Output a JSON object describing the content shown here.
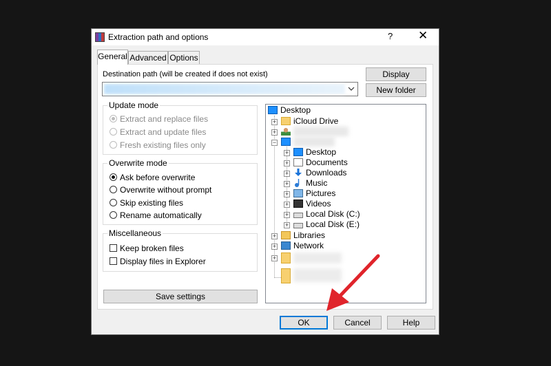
{
  "window": {
    "title": "Extraction path and options",
    "help_label": "?",
    "close_label": "✕"
  },
  "tabs": [
    {
      "label": "General"
    },
    {
      "label": "Advanced"
    },
    {
      "label": "Options"
    }
  ],
  "destination": {
    "label": "Destination path (will be created if does not exist)",
    "value": "",
    "dropdown_icon": "chevron-down-icon"
  },
  "side_buttons": {
    "display": "Display",
    "new_folder": "New folder"
  },
  "update_mode": {
    "title": "Update mode",
    "options": [
      {
        "label": "Extract and replace files",
        "checked": true
      },
      {
        "label": "Extract and update files",
        "checked": false
      },
      {
        "label": "Fresh existing files only",
        "checked": false
      }
    ]
  },
  "overwrite_mode": {
    "title": "Overwrite mode",
    "options": [
      {
        "label": "Ask before overwrite",
        "checked": true
      },
      {
        "label": "Overwrite without prompt",
        "checked": false
      },
      {
        "label": "Skip existing files",
        "checked": false
      },
      {
        "label": "Rename automatically",
        "checked": false
      }
    ]
  },
  "misc": {
    "title": "Miscellaneous",
    "options": [
      {
        "label": "Keep broken files",
        "checked": false
      },
      {
        "label": "Display files in Explorer",
        "checked": false
      }
    ]
  },
  "save_settings": "Save settings",
  "tree": {
    "root": "Desktop",
    "items": [
      {
        "label": "iCloud Drive",
        "icon": "folder-icon"
      },
      {
        "label": "",
        "icon": "user-icon"
      },
      {
        "label": "",
        "icon": "monitor-icon"
      },
      {
        "label": "Desktop",
        "icon": "monitor-icon"
      },
      {
        "label": "Documents",
        "icon": "document-icon"
      },
      {
        "label": "Downloads",
        "icon": "download-icon"
      },
      {
        "label": "Music",
        "icon": "music-icon"
      },
      {
        "label": "Pictures",
        "icon": "pictures-icon"
      },
      {
        "label": "Videos",
        "icon": "videos-icon"
      },
      {
        "label": "Local Disk (C:)",
        "icon": "disk-icon"
      },
      {
        "label": "Local Disk (E:)",
        "icon": "disk-icon"
      },
      {
        "label": "Libraries",
        "icon": "libraries-icon"
      },
      {
        "label": "Network",
        "icon": "network-icon"
      },
      {
        "label": "",
        "icon": "folder-icon"
      },
      {
        "label": "",
        "icon": "folder-icon"
      }
    ]
  },
  "footer": {
    "ok": "OK",
    "cancel": "Cancel",
    "help": "Help"
  },
  "colors": {
    "background": "#151515",
    "annotation_arrow": "#e0242b",
    "default_button_border": "#0078d7"
  }
}
